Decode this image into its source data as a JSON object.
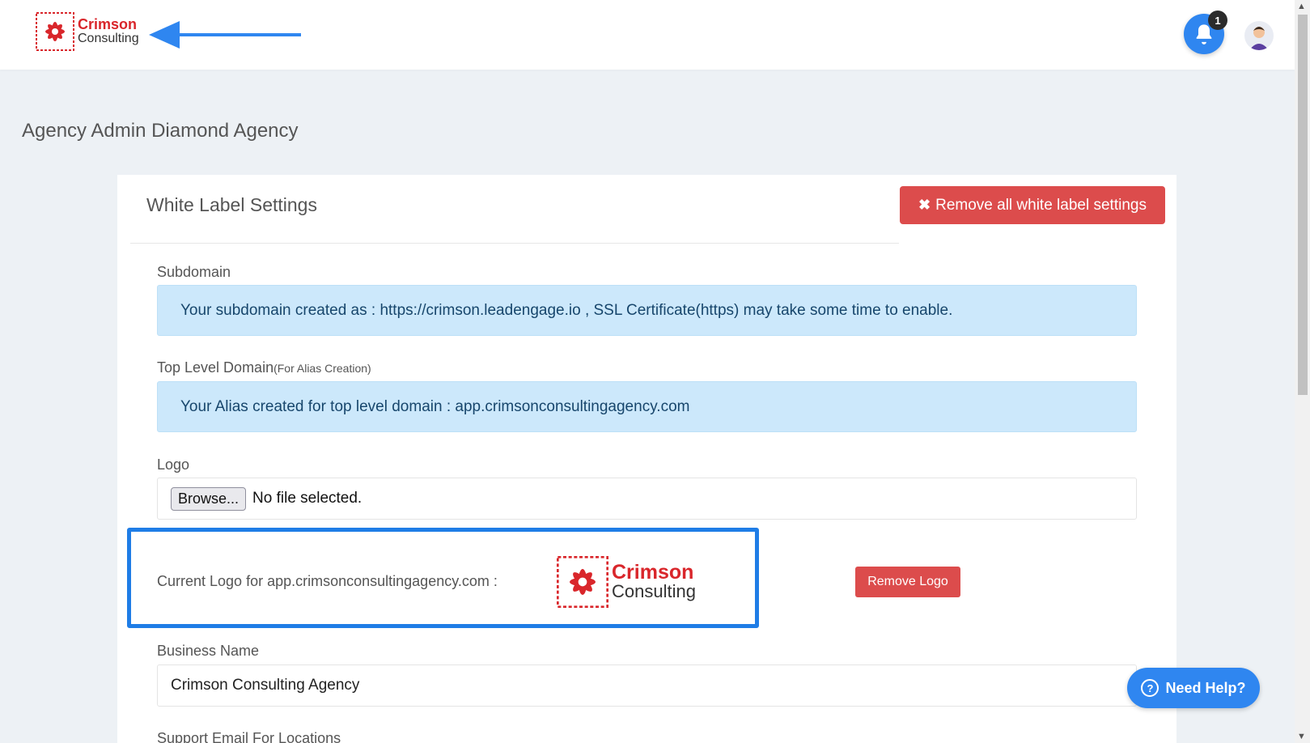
{
  "brand": {
    "line1": "Crimson",
    "line2": "Consulting"
  },
  "header": {
    "notification_count": "1"
  },
  "page": {
    "title": "Agency Admin Diamond Agency"
  },
  "card": {
    "title": "White Label Settings",
    "remove_all_label": "Remove all white label settings",
    "subdomain": {
      "label": "Subdomain",
      "message": "Your subdomain created as : https://crimson.leadengage.io , SSL Certificate(https) may take some time to enable."
    },
    "tld": {
      "label": "Top Level Domain",
      "hint": "(For Alias Creation)",
      "message": "Your Alias created for top level domain : app.crimsonconsultingagency.com"
    },
    "logo": {
      "label": "Logo",
      "browse_label": "Browse...",
      "file_status": "No file selected.",
      "current_label": "Current Logo for app.crimsonconsultingagency.com :",
      "remove_label": "Remove Logo"
    },
    "business_name": {
      "label": "Business Name",
      "value": "Crimson Consulting Agency"
    },
    "support_email": {
      "label": "Support Email For Locations"
    }
  },
  "help": {
    "label": "Need Help?"
  },
  "colors": {
    "accent": "#2f86f0",
    "danger": "#dc4c4c",
    "info_bg": "#cce8fb",
    "brand_red": "#d9262b"
  }
}
